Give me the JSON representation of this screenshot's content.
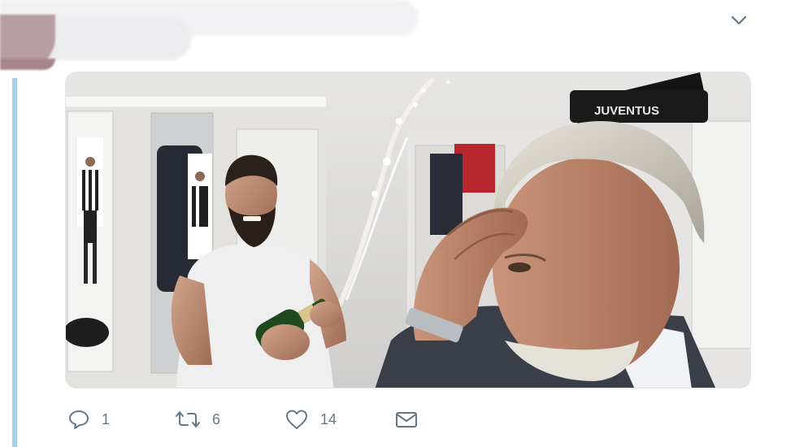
{
  "tweet": {
    "header_obscured": true,
    "menu_icon": "chevron-down-icon",
    "media": {
      "image": "celebration-photo",
      "jersey_text": "JUVENTUS"
    },
    "actions": {
      "reply": {
        "icon": "reply-icon",
        "count": "1"
      },
      "retweet": {
        "icon": "retweet-icon",
        "count": "6"
      },
      "like": {
        "icon": "heart-icon",
        "count": "14"
      },
      "message": {
        "icon": "envelope-icon"
      }
    }
  },
  "colors": {
    "icon": "#657786",
    "thread_line": "#a8d3ea",
    "border": "#e1e8ed"
  }
}
